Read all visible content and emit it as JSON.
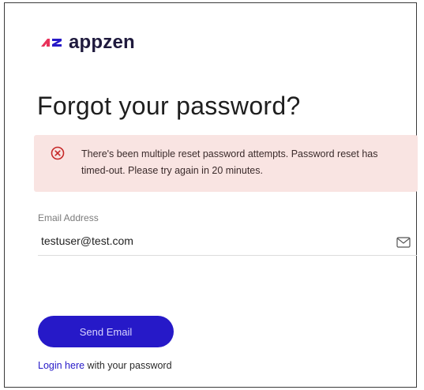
{
  "brand": {
    "name": "appzen",
    "logo_icon": "appzen-logo-mark",
    "text_color": "#1f1a3d",
    "mark_colors": [
      "#e8325a",
      "#2619c8"
    ]
  },
  "page": {
    "title": "Forgot your password?"
  },
  "alert": {
    "icon": "error-circle-x-icon",
    "message": "There's been multiple reset password attempts. Password reset has timed-out. Please try again in 20 minutes.",
    "background": "#f9e4e2",
    "icon_color": "#c62828"
  },
  "form": {
    "email_label": "Email Address",
    "email_value": "testuser@test.com",
    "email_icon": "envelope-icon",
    "submit_label": "Send Email",
    "submit_color": "#2619c8"
  },
  "footer": {
    "login_link": "Login here",
    "login_suffix": " with your password"
  }
}
